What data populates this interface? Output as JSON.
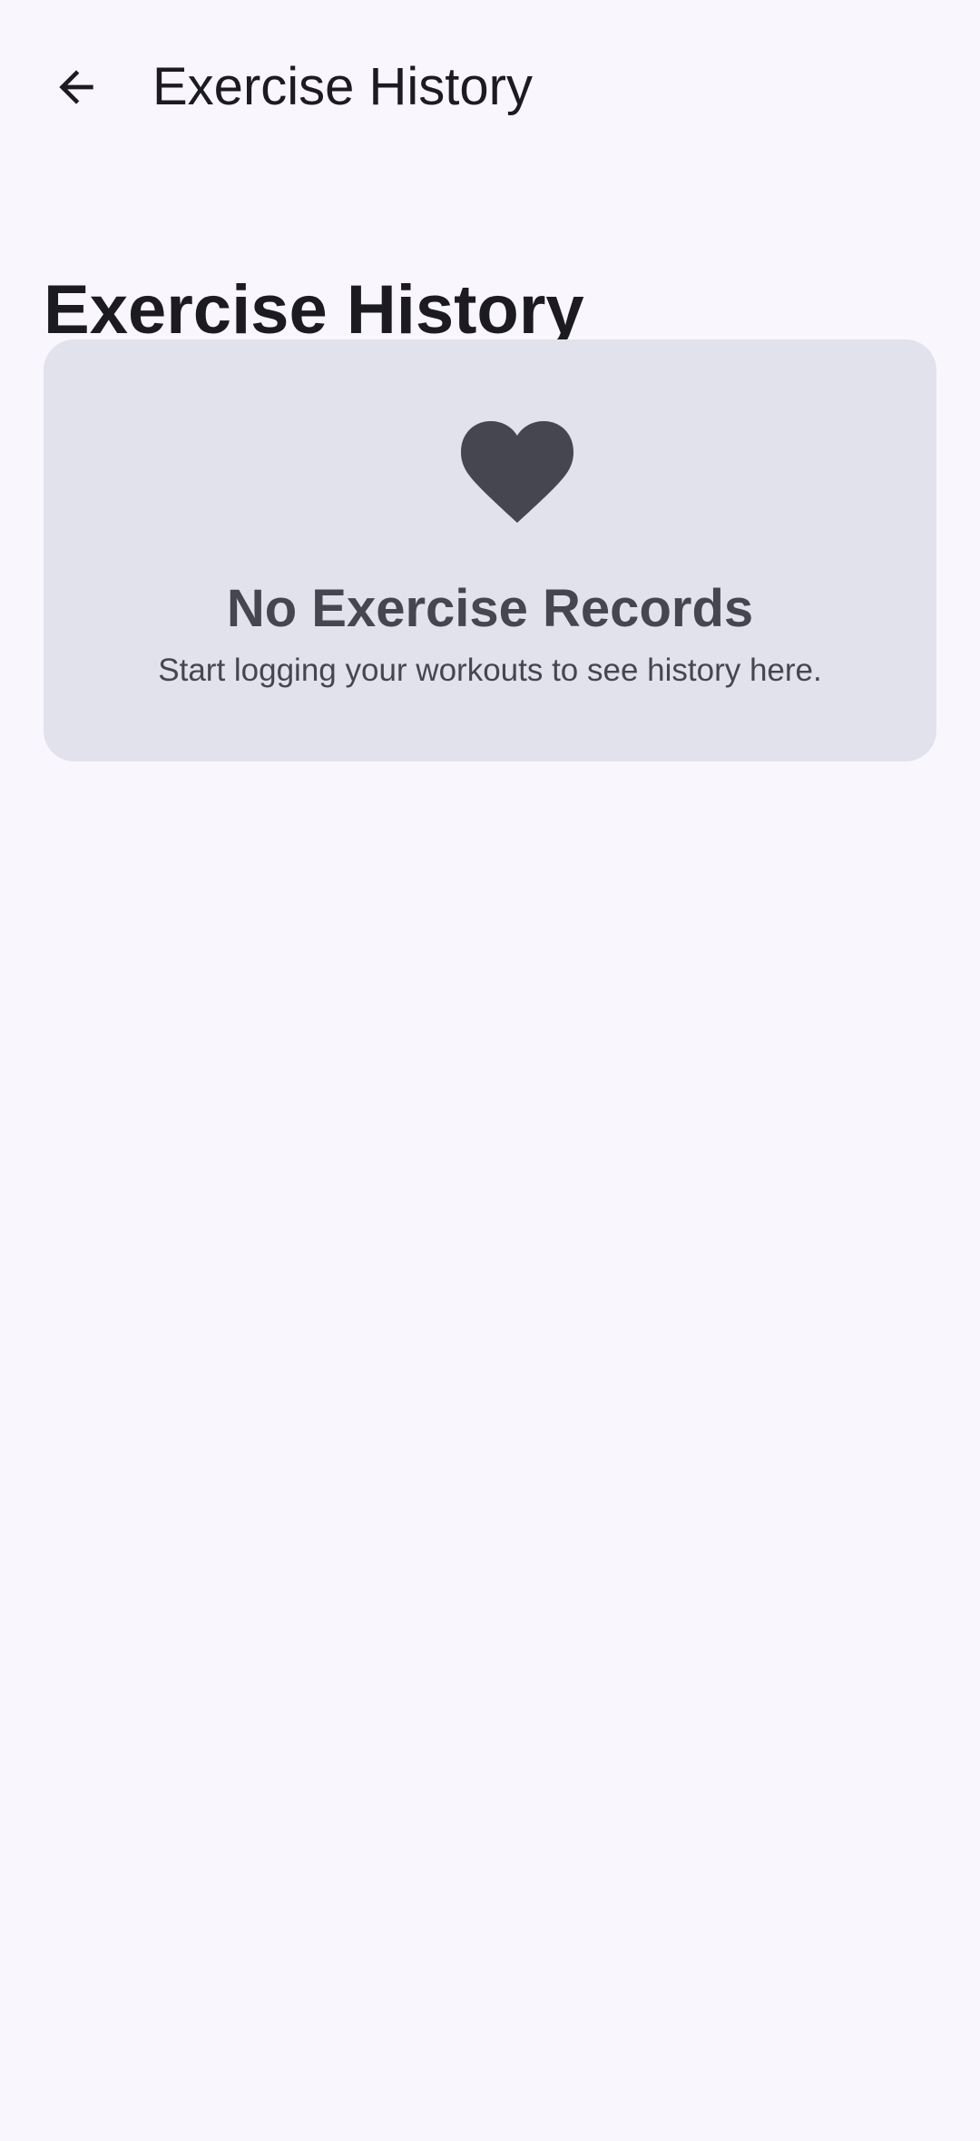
{
  "app_bar": {
    "title": "Exercise History",
    "back_icon": "arrow-back-icon"
  },
  "page": {
    "heading": "Exercise History"
  },
  "empty_state": {
    "icon": "heart-icon",
    "title": "No Exercise Records",
    "message": "Start logging your workouts to see history here."
  },
  "colors": {
    "background": "#f9f7fd",
    "card_background": "#e1e2ec",
    "primary_text": "#1c1b1f",
    "secondary_text": "#45464f"
  }
}
